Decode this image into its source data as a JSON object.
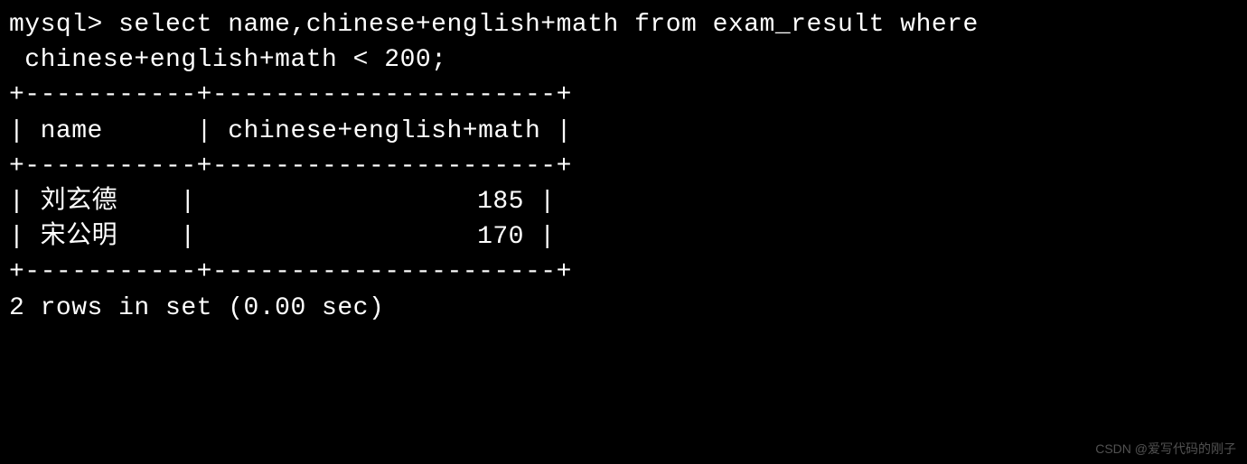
{
  "terminal": {
    "prompt": "mysql> ",
    "query_line1": "select name,chinese+english+math from exam_result where",
    "query_line2": " chinese+english+math < 200;",
    "separator": "+-----------+----------------------+",
    "header_row": "| name      | chinese+english+math |",
    "data_row1": "| 刘玄德    |                  185 |",
    "data_row2": "| 宋公明    |                  170 |",
    "footer": "2 rows in set (0.00 sec)"
  },
  "table": {
    "columns": [
      "name",
      "chinese+english+math"
    ],
    "rows": [
      {
        "name": "刘玄德",
        "total": 185
      },
      {
        "name": "宋公明",
        "total": 170
      }
    ],
    "row_count": 2,
    "execution_time": "0.00 sec"
  },
  "watermark": "CSDN @爱写代码的刚子"
}
